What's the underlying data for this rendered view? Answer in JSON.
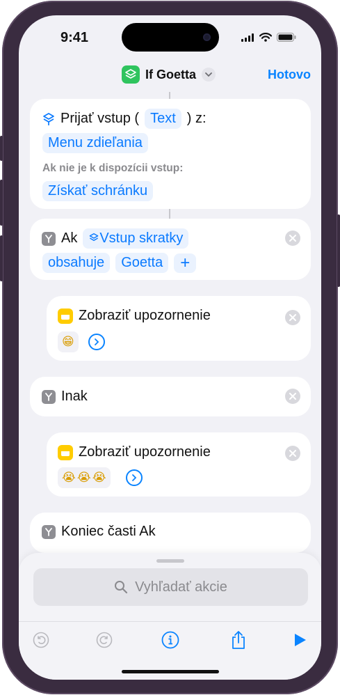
{
  "status_bar": {
    "time": "9:41"
  },
  "nav": {
    "title": "If Goetta",
    "done_label": "Hotovo"
  },
  "actions": {
    "receive": {
      "prefix": "Prijať vstup (",
      "type_chip": "Text",
      "suffix": ") z:",
      "source_chip": "Menu zdieľania",
      "fallback_label": "Ak nie je k dispozícii vstup:",
      "fallback_chip": "Získať schránku"
    },
    "if": {
      "label": "Ak",
      "input_chip": "Vstup skratky",
      "condition_chip": "obsahuje",
      "value_chip": "Goetta",
      "add_chip": "+"
    },
    "alert1": {
      "label": "Zobraziť upozornenie",
      "emoji_count": 1
    },
    "otherwise": {
      "label": "Inak"
    },
    "alert2": {
      "label": "Zobraziť upozornenie",
      "emoji_count": 3
    },
    "end_if": {
      "label": "Koniec časti Ak"
    }
  },
  "bottom": {
    "search_placeholder": "Vyhľadať akcie"
  },
  "colors": {
    "accent": "#0a84ff",
    "background": "#f1f1f6",
    "app_icon": "#2fc45e",
    "alert_icon": "#ffcc00"
  },
  "icons": {
    "undo": "undo-icon",
    "redo": "redo-icon",
    "info": "info-icon",
    "share": "share-icon",
    "run": "play-icon",
    "search": "search-icon",
    "alert1_emoji": "grinning-face-emoji",
    "alert2_emoji": "loudly-crying-face-emoji"
  }
}
